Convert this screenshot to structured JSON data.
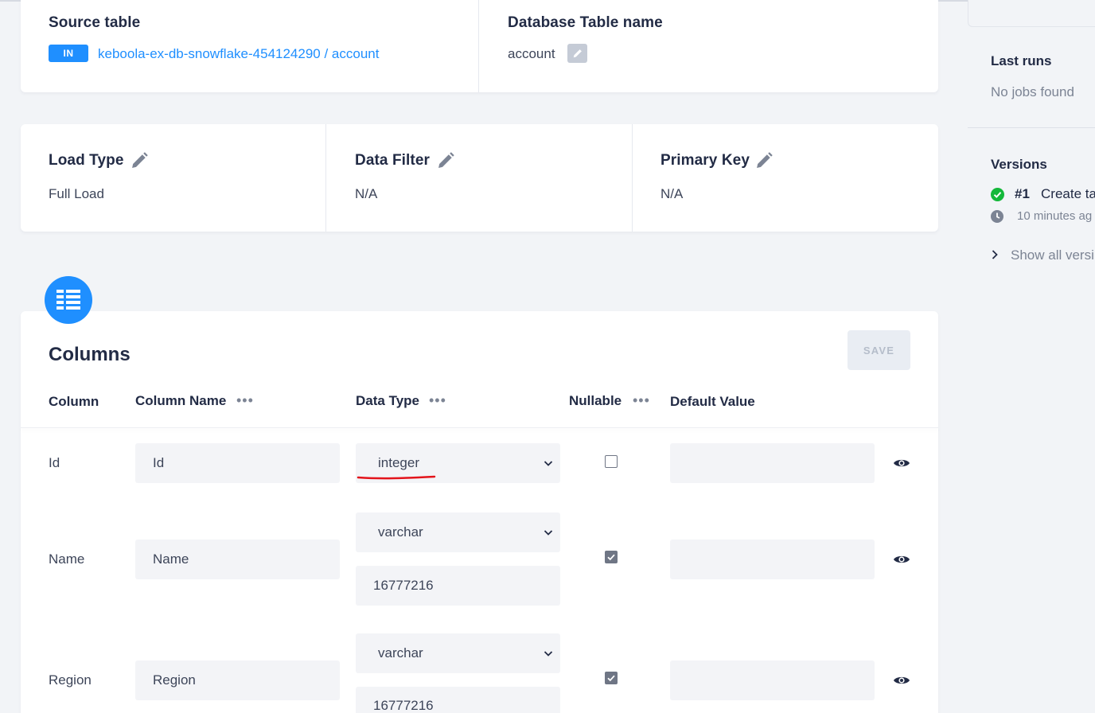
{
  "source": {
    "label": "Source table",
    "badge": "IN",
    "link": "keboola-ex-db-snowflake-454124290 / account"
  },
  "destination": {
    "label": "Database Table name",
    "value": "account"
  },
  "settings": {
    "load_type": {
      "label": "Load Type",
      "value": "Full Load"
    },
    "data_filter": {
      "label": "Data Filter",
      "value": "N/A"
    },
    "primary_key": {
      "label": "Primary Key",
      "value": "N/A"
    }
  },
  "columns": {
    "title": "Columns",
    "save_label": "SAVE",
    "headers": {
      "column": "Column",
      "column_name": "Column Name",
      "data_type": "Data Type",
      "nullable": "Nullable",
      "default_value": "Default Value"
    },
    "rows": [
      {
        "column": "Id",
        "name": "Id",
        "type": "integer",
        "length": "",
        "nullable": false,
        "default": ""
      },
      {
        "column": "Name",
        "name": "Name",
        "type": "varchar",
        "length": "16777216",
        "nullable": true,
        "default": ""
      },
      {
        "column": "Region",
        "name": "Region",
        "type": "varchar",
        "length": "16777216",
        "nullable": true,
        "default": ""
      }
    ]
  },
  "sidebar": {
    "last_runs_label": "Last runs",
    "last_runs_value": "No jobs found",
    "versions_label": "Versions",
    "version_number": "#1",
    "version_text": "Create ta",
    "version_time": "10 minutes ag",
    "show_all": "Show all versi"
  },
  "colors": {
    "accent": "#1f8fff",
    "success": "#14b83a",
    "annotation": "#e3141b"
  }
}
